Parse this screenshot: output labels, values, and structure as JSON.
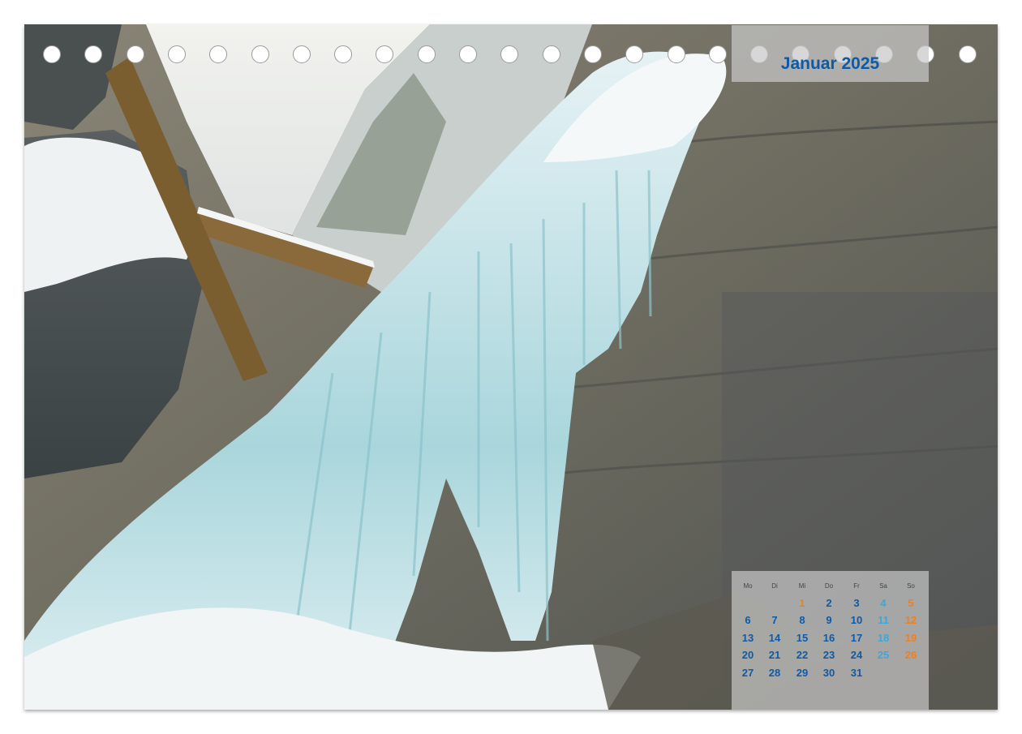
{
  "calendar": {
    "month_title": "Januar 2025",
    "weekdays": [
      "Mo",
      "Di",
      "Mi",
      "Do",
      "Fr",
      "Sa",
      "So"
    ],
    "colors": {
      "weekday": "#0f5aa6",
      "saturday": "#3fa7d8",
      "sunday": "#f07f1e",
      "holiday": "#f07f1e"
    },
    "weeks": [
      [
        null,
        null,
        {
          "d": "1",
          "t": "holiday"
        },
        {
          "d": "2",
          "t": "weekday"
        },
        {
          "d": "3",
          "t": "weekday"
        },
        {
          "d": "4",
          "t": "saturday"
        },
        {
          "d": "5",
          "t": "sunday"
        }
      ],
      [
        {
          "d": "6",
          "t": "weekday"
        },
        {
          "d": "7",
          "t": "weekday"
        },
        {
          "d": "8",
          "t": "weekday"
        },
        {
          "d": "9",
          "t": "weekday"
        },
        {
          "d": "10",
          "t": "weekday"
        },
        {
          "d": "11",
          "t": "saturday"
        },
        {
          "d": "12",
          "t": "sunday"
        }
      ],
      [
        {
          "d": "13",
          "t": "weekday"
        },
        {
          "d": "14",
          "t": "weekday"
        },
        {
          "d": "15",
          "t": "weekday"
        },
        {
          "d": "16",
          "t": "weekday"
        },
        {
          "d": "17",
          "t": "weekday"
        },
        {
          "d": "18",
          "t": "saturday"
        },
        {
          "d": "19",
          "t": "sunday"
        }
      ],
      [
        {
          "d": "20",
          "t": "weekday"
        },
        {
          "d": "21",
          "t": "weekday"
        },
        {
          "d": "22",
          "t": "weekday"
        },
        {
          "d": "23",
          "t": "weekday"
        },
        {
          "d": "24",
          "t": "weekday"
        },
        {
          "d": "25",
          "t": "saturday"
        },
        {
          "d": "26",
          "t": "sunday"
        }
      ],
      [
        {
          "d": "27",
          "t": "weekday"
        },
        {
          "d": "28",
          "t": "weekday"
        },
        {
          "d": "29",
          "t": "weekday"
        },
        {
          "d": "30",
          "t": "weekday"
        },
        {
          "d": "31",
          "t": "weekday"
        },
        null,
        null
      ]
    ]
  },
  "binding_hole_count": 23
}
